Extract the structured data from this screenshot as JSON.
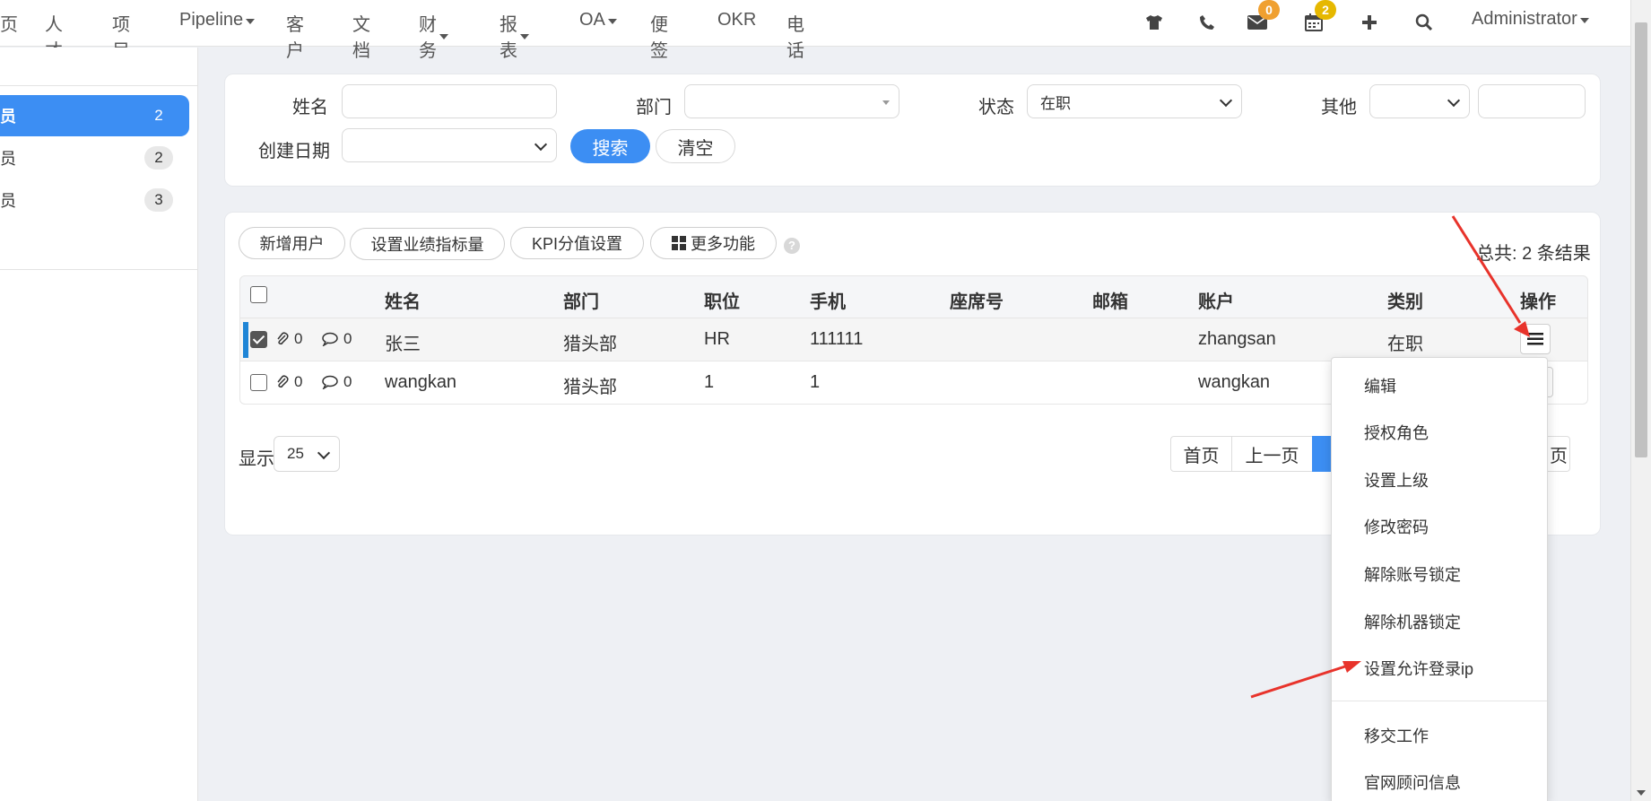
{
  "nav": {
    "items": [
      {
        "label": "页",
        "caret": false
      },
      {
        "label": "人才",
        "caret": false
      },
      {
        "label": "项目",
        "caret": false
      },
      {
        "label": "Pipeline",
        "caret": true
      },
      {
        "label": "客户",
        "caret": false
      },
      {
        "label": "文档",
        "caret": false
      },
      {
        "label": "财务",
        "caret": true
      },
      {
        "label": "报表",
        "caret": true
      },
      {
        "label": "OA",
        "caret": true
      },
      {
        "label": "便签",
        "caret": false
      },
      {
        "label": "OKR",
        "caret": false
      },
      {
        "label": "电话",
        "caret": false
      }
    ],
    "mail_badge": "0",
    "calendar_badge": "2",
    "mail_badge_color": "#f0a030",
    "calendar_badge_color": "#e6b800",
    "user": "Administrator"
  },
  "sidebar": {
    "items": [
      {
        "label": "员",
        "count": "2",
        "active": true
      },
      {
        "label": "员",
        "count": "2",
        "active": false
      },
      {
        "label": "员",
        "count": "3",
        "active": false
      }
    ]
  },
  "filters": {
    "name_label": "姓名",
    "name_value": "",
    "dept_label": "部门",
    "dept_value": "",
    "status_label": "状态",
    "status_value": "在职",
    "other_label": "其他",
    "other_value": "",
    "other_text": "",
    "created_label": "创建日期",
    "created_value": "",
    "search_btn": "搜索",
    "clear_btn": "清空"
  },
  "toolbar": {
    "add_user": "新增用户",
    "set_kpi_target": "设置业绩指标量",
    "kpi_score": "KPI分值设置",
    "more": "更多功能",
    "total": "总共: 2 条结果"
  },
  "table": {
    "headers": [
      "姓名",
      "部门",
      "职位",
      "手机",
      "座席号",
      "邮箱",
      "账户",
      "类别",
      "操作"
    ],
    "rows": [
      {
        "checked": true,
        "attachments": "0",
        "comments": "0",
        "name": "张三",
        "dept": "猎头部",
        "position": "HR",
        "phone": "111111",
        "seat": "",
        "email": "",
        "account": "zhangsan",
        "category": "在职"
      },
      {
        "checked": false,
        "attachments": "0",
        "comments": "0",
        "name": "wangkan",
        "dept": "猎头部",
        "position": "1",
        "phone": "1",
        "seat": "",
        "email": "",
        "account": "wangkan",
        "category": ""
      }
    ]
  },
  "pagination": {
    "show_label": "显示",
    "page_size": "25",
    "first": "首页",
    "prev": "上一页",
    "last_fragment": "页"
  },
  "menu": {
    "items": [
      "编辑",
      "授权角色",
      "设置上级",
      "修改密码",
      "解除账号锁定",
      "解除机器锁定",
      "设置允许登录ip"
    ],
    "items_after_divider": [
      "移交工作",
      "官网顾问信息"
    ]
  },
  "colors": {
    "primary": "#3c8ef3",
    "annotation": "#e8332b"
  }
}
